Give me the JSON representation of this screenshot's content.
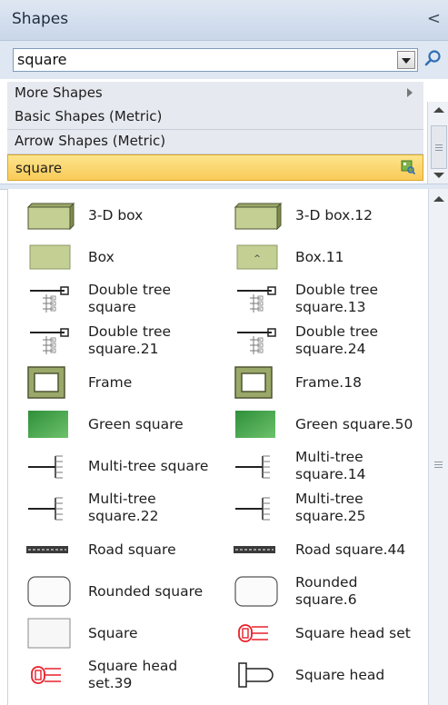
{
  "panel": {
    "title": "Shapes",
    "collapse_glyph": "<",
    "search": {
      "value": "square",
      "placeholder": ""
    },
    "stencils": [
      {
        "label": "More Shapes"
      },
      {
        "label": "Basic Shapes (Metric)"
      },
      {
        "label": "Arrow Shapes (Metric)"
      },
      {
        "label": "square"
      }
    ]
  },
  "shapes": [
    {
      "label": "3-D box",
      "icon": "3d-box-icon"
    },
    {
      "label": "3-D box.12",
      "icon": "3d-box-icon"
    },
    {
      "label": "Box",
      "icon": "box-icon"
    },
    {
      "label": "Box.11",
      "icon": "box-icon"
    },
    {
      "label": "Double tree square",
      "icon": "double-tree-icon"
    },
    {
      "label": "Double tree square.13",
      "icon": "double-tree-icon"
    },
    {
      "label": "Double tree square.21",
      "icon": "double-tree-icon"
    },
    {
      "label": "Double tree square.24",
      "icon": "double-tree-icon"
    },
    {
      "label": "Frame",
      "icon": "frame-icon"
    },
    {
      "label": "Frame.18",
      "icon": "frame-icon"
    },
    {
      "label": "Green square",
      "icon": "green-square-icon"
    },
    {
      "label": "Green square.50",
      "icon": "green-square-icon"
    },
    {
      "label": "Multi-tree square",
      "icon": "multi-tree-icon"
    },
    {
      "label": "Multi-tree square.14",
      "icon": "multi-tree-icon"
    },
    {
      "label": "Multi-tree square.22",
      "icon": "multi-tree-icon"
    },
    {
      "label": "Multi-tree square.25",
      "icon": "multi-tree-icon"
    },
    {
      "label": "Road square",
      "icon": "road-icon"
    },
    {
      "label": "Road square.44",
      "icon": "road-icon"
    },
    {
      "label": "Rounded square",
      "icon": "rounded-square-icon"
    },
    {
      "label": "Rounded square.6",
      "icon": "rounded-square-icon"
    },
    {
      "label": "Square",
      "icon": "square-icon"
    },
    {
      "label": "Square head set",
      "icon": "square-head-set-icon"
    },
    {
      "label": "Square head set.39",
      "icon": "square-head-set-icon"
    },
    {
      "label": "Square head",
      "icon": "square-head-icon"
    }
  ],
  "colors": {
    "accent_yellow": "#f9cb58",
    "shape_fill": "#c3cf93",
    "green_fill": "#43a547",
    "head_red": "#e8202a"
  }
}
